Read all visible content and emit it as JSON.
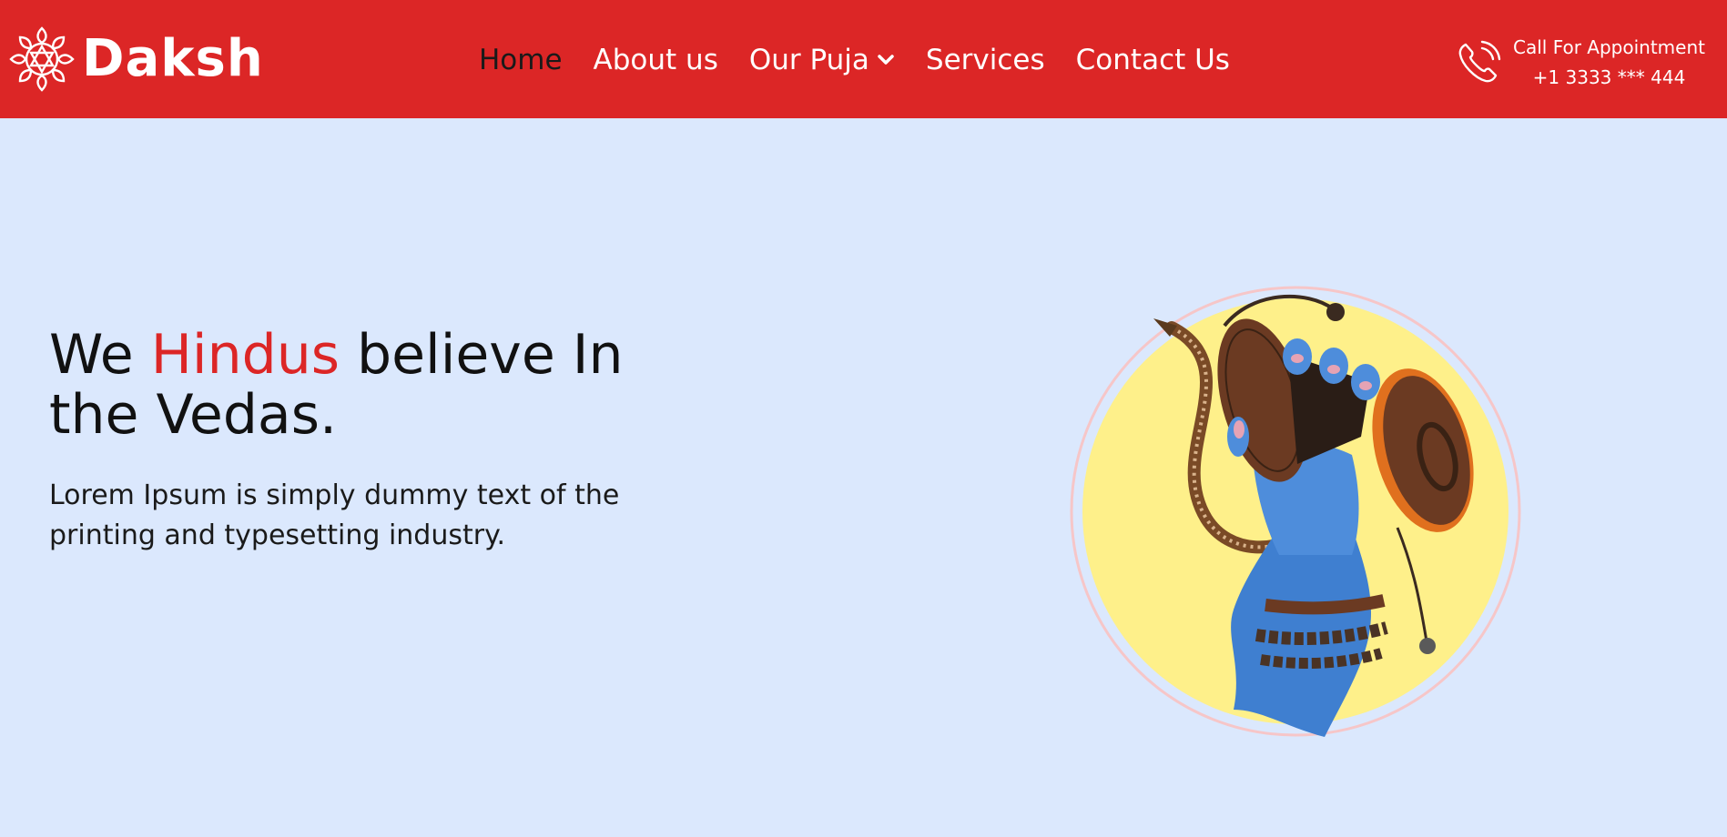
{
  "header": {
    "brand": {
      "name": "Daksh",
      "logo_icon": "star-of-david-lotus-icon"
    },
    "nav": [
      {
        "label": "Home",
        "active": true
      },
      {
        "label": "About us"
      },
      {
        "label": "Our Puja",
        "has_dropdown": true
      },
      {
        "label": "Services"
      },
      {
        "label": "Contact Us"
      }
    ],
    "contact": {
      "icon": "phone-icon",
      "label": "Call For Appointment",
      "phone": "+1 3333 *** 444"
    }
  },
  "hero": {
    "title_before": "We ",
    "title_accent": "Hindus",
    "title_after": " believe In the Vedas.",
    "description": "Lorem Ipsum is simply dummy text of the printing and typesetting industry.",
    "image": "shiva-hand-damaru-snake-illustration"
  },
  "colors": {
    "header_bg": "#dc2626",
    "page_bg": "#dbe8fd",
    "accent": "#dc2626",
    "circle_fill": "#fef08a",
    "hand_blue": "#3f7fd0",
    "drum_brown": "#6b3a22"
  }
}
